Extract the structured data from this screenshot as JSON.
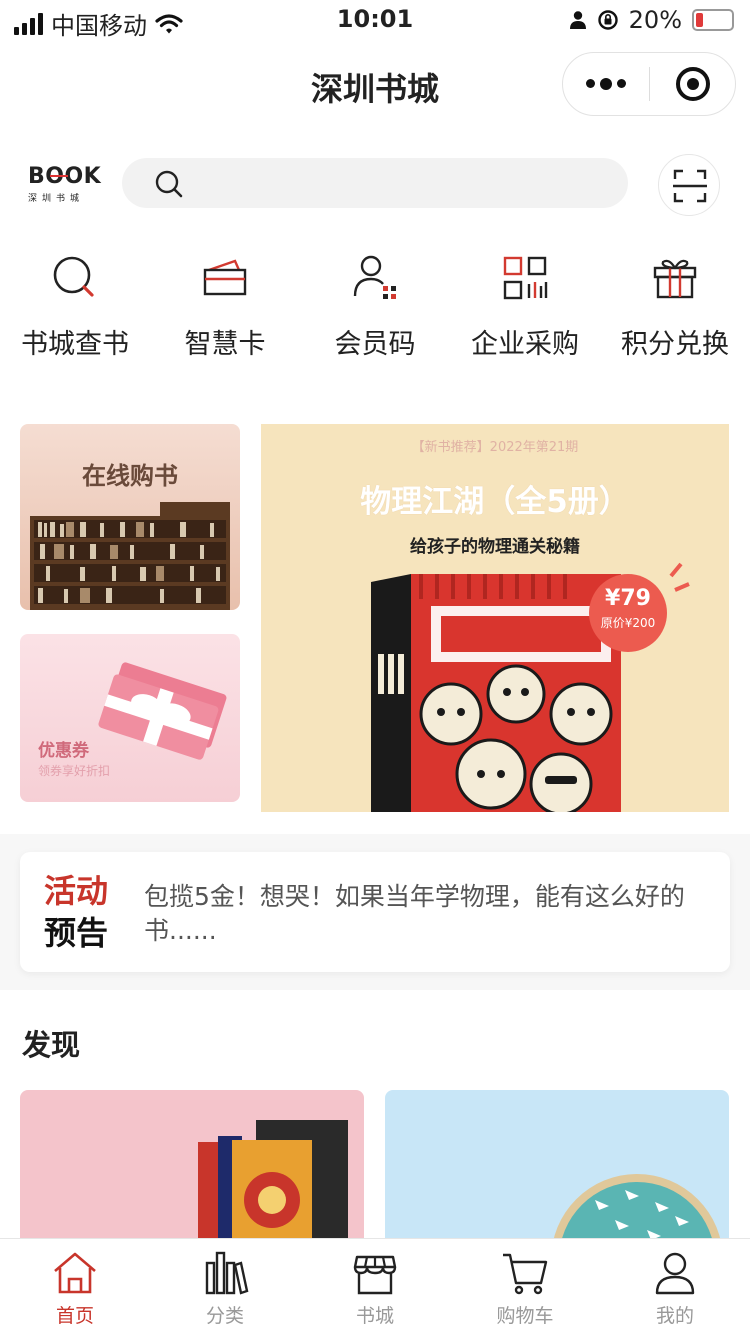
{
  "status_bar": {
    "carrier": "中国移动",
    "time": "10:01",
    "battery": "20%",
    "battery_level": 0.2
  },
  "title_bar": {
    "title": "深圳书城"
  },
  "logo": {
    "main": "BOOK",
    "sub": "深圳书城"
  },
  "search": {
    "placeholder": ""
  },
  "quick_nav": [
    {
      "label": "书城查书",
      "icon": "search-book-icon"
    },
    {
      "label": "智慧卡",
      "icon": "card-icon"
    },
    {
      "label": "会员码",
      "icon": "member-code-icon"
    },
    {
      "label": "企业采购",
      "icon": "enterprise-purchase-icon"
    },
    {
      "label": "积分兑换",
      "icon": "gift-icon"
    }
  ],
  "promo": {
    "online_title": "在线购书",
    "coupon_title": "优惠券",
    "coupon_sub": "领券享好折扣",
    "banner": {
      "top_text": "【新书推荐】2022年第21期",
      "title": "物理江湖（全5册）",
      "subtitle": "给孩子的物理通关秘籍",
      "price": "¥79",
      "original_price": "原价¥200"
    }
  },
  "activity": {
    "tag_line1": "活动",
    "tag_line2": "预告",
    "text": "包揽5金！想哭！如果当年学物理，能有这么好的书......"
  },
  "discover": {
    "title": "发现"
  },
  "tab_bar": [
    {
      "label": "首页",
      "icon": "home-icon",
      "active": true
    },
    {
      "label": "分类",
      "icon": "category-icon",
      "active": false
    },
    {
      "label": "书城",
      "icon": "store-icon",
      "active": false
    },
    {
      "label": "购物车",
      "icon": "cart-icon",
      "active": false
    },
    {
      "label": "我的",
      "icon": "profile-icon",
      "active": false
    }
  ],
  "colors": {
    "accent": "#c8352b",
    "banner_bg": "#f6e4bd",
    "price_badge": "#ec5b4f"
  }
}
